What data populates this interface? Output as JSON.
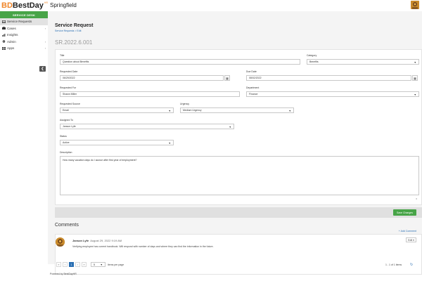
{
  "app": {
    "logo_mark": "BD",
    "logo_text": "BestDay",
    "logo_sup": "HR",
    "org_name": "Springfield"
  },
  "sidebar": {
    "header": "SERVICE DESK",
    "items": [
      {
        "label": "Service Requests",
        "icon": "inbox-icon"
      },
      {
        "label": "Cases",
        "icon": "briefcase-icon"
      },
      {
        "label": "Insights",
        "icon": "chart-icon"
      },
      {
        "label": "Admin",
        "icon": "gear-icon"
      },
      {
        "label": "Apps",
        "icon": "grid-icon"
      }
    ],
    "collapse_glyph": "❮"
  },
  "page": {
    "title": "Service Request",
    "breadcrumb": "Service Requests > Edit",
    "sr_id": "SR.2022.6.001"
  },
  "form": {
    "title_label": "Title",
    "title_value": "Question about Benefits",
    "category_label": "Category",
    "category_value": "Benefits",
    "requested_date_label": "Requested Date",
    "requested_date_value": "06/29/2022",
    "due_date_label": "Due Date",
    "due_date_value": "08/02/2022",
    "requested_for_label": "Requested For",
    "requested_for_value": "Shawn Miller",
    "department_label": "Department",
    "department_value": "Finance",
    "source_label": "Requested Source",
    "source_value": "Email",
    "urgency_label": "Urgency",
    "urgency_value": "Medium Urgency",
    "assigned_label": "Assigned To",
    "assigned_value": "Janson Lyfe",
    "status_label": "Status",
    "status_value": "Active",
    "description_label": "Description",
    "description_value": "How many vacation days do I accrue after first year of employment?",
    "char_count": "0",
    "save_label": "Save Changes"
  },
  "comments": {
    "title": "Comments",
    "add_label": "+ Add Comment",
    "items": [
      {
        "author": "Janson Lyfe",
        "date": "August 29, 2022 9:19 AM",
        "text": "Verifying employee has current handbook. Will respond with number of days and where they can find the information in the future.",
        "edit_label": "Edit ▾"
      }
    ]
  },
  "pager": {
    "first": "«",
    "prev": "‹",
    "current": "1",
    "next": "›",
    "last": "»",
    "per_page_value": "5",
    "per_page_label": "items per page",
    "count_text": "1 - 1 of 1 items"
  },
  "footer": {
    "text": "Powered by BestDayHR"
  },
  "colors": {
    "accent_green": "#47a447",
    "link_blue": "#2a6fb3",
    "logo_orange": "#f0862a"
  }
}
